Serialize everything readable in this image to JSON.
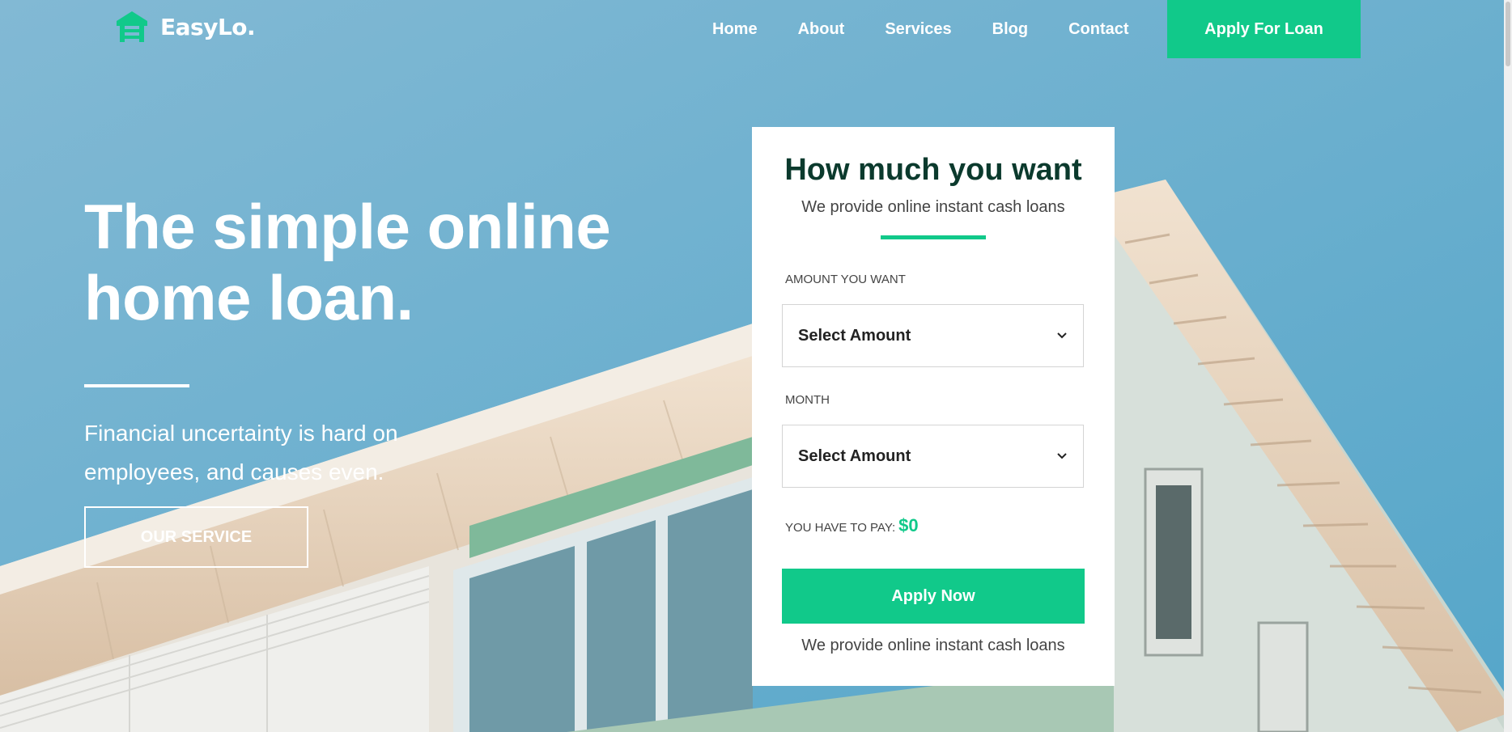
{
  "brand": {
    "name": "EasyLo.",
    "logo_icon": "house-icon",
    "accent": "#11c98a"
  },
  "nav": {
    "items": [
      {
        "label": "Home"
      },
      {
        "label": "About"
      },
      {
        "label": "Services"
      },
      {
        "label": "Blog"
      },
      {
        "label": "Contact"
      }
    ],
    "cta_label": "Apply For Loan"
  },
  "hero": {
    "title_line1": "The simple online",
    "title_line2": "home loan.",
    "subtitle": "Financial uncertainty is hard on employees, and causes even.",
    "service_button": "OUR SERVICE"
  },
  "loan_form": {
    "title": "How much you want",
    "subtitle": "We provide online instant cash loans",
    "amount_label": "AMOUNT YOU WANT",
    "amount_value": "Select Amount",
    "month_label": "MONTH",
    "month_value": "Select Amount",
    "pay_label": "YOU HAVE TO PAY:",
    "pay_value": "$0",
    "apply_button": "Apply Now",
    "footer_note": "We provide online instant cash loans"
  }
}
